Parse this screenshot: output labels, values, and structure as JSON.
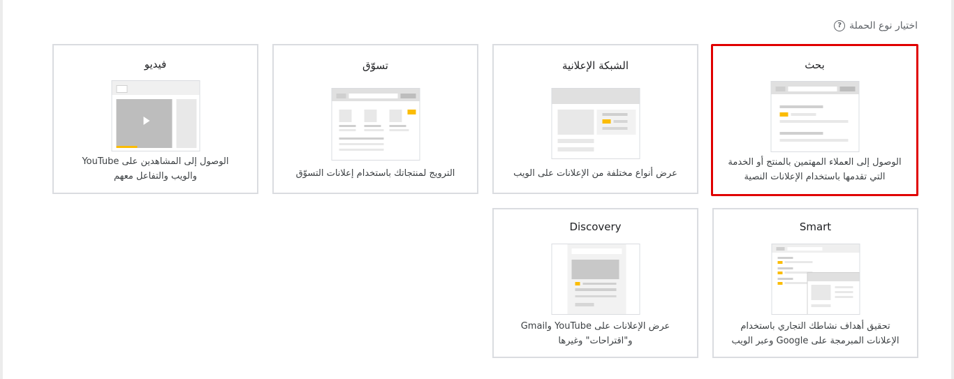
{
  "section": {
    "title": "اختيار نوع الحملة",
    "help_glyph": "?"
  },
  "cards": {
    "search": {
      "title": "بحث",
      "desc_1": "الوصول إلى العملاء المهتمين بالمنتج أو الخدمة",
      "desc_2": "التي تقدمها باستخدام الإعلانات النصية",
      "selected": true
    },
    "display": {
      "title": "الشبكة الإعلانية",
      "desc_1": "عرض أنواع مختلفة من الإعلانات على الويب"
    },
    "shopping": {
      "title": "تسوّق",
      "desc_1": "الترويج لمنتجاتك باستخدام إعلانات التسوّق"
    },
    "video": {
      "title": "فيديو",
      "desc_1": "الوصول إلى المشاهدين على YouTube",
      "desc_2": "والويب والتفاعل معهم"
    },
    "smart": {
      "title": "Smart",
      "desc_1": "تحقيق أهداف نشاطك التجاري باستخدام",
      "desc_2": "الإعلانات المبرمجة على Google وعبر الويب"
    },
    "discovery": {
      "title": "Discovery",
      "desc_1": "عرض الإعلانات على YouTube وGmail",
      "desc_2": "و\"اقتراحات\" وغيرها"
    }
  },
  "colors": {
    "selected_border": "#e00000",
    "accent_yellow": "#fbbc04",
    "card_border": "#dadce0"
  }
}
